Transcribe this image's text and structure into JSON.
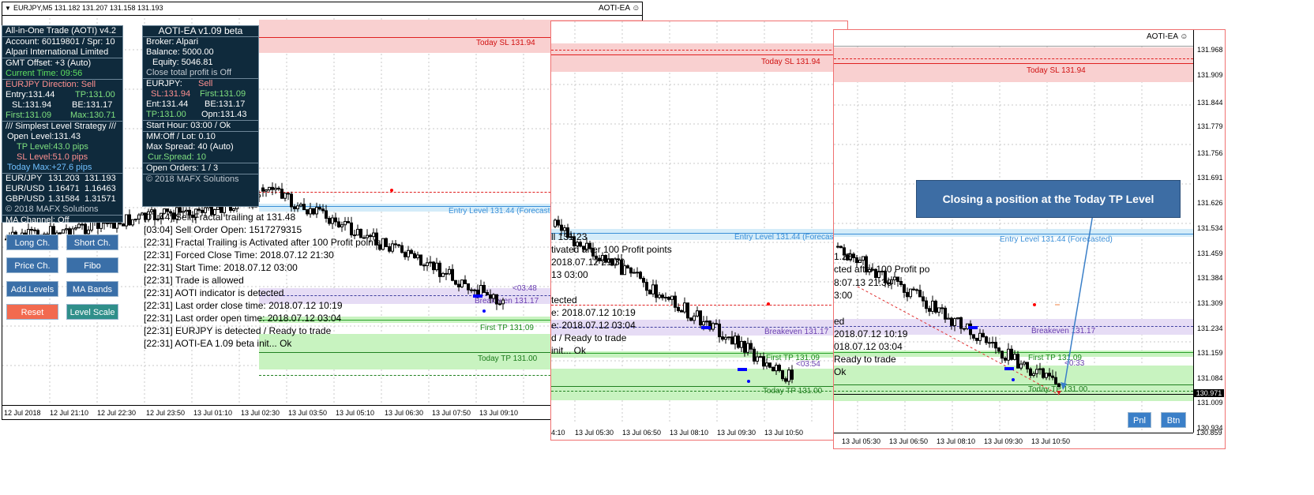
{
  "charts": {
    "c1": {
      "header": "EURJPY,M5  131.182 131.207 131.158 131.193",
      "indicator": "AOTI-EA ☺",
      "sl_label": "Today SL 131.94",
      "entry_label": "Entry Level 131.44 (Forecasted)",
      "be_label": "Breakeven 131.17",
      "first_label": "First TP 131.09",
      "tp_label": "Today TP 131.00",
      "countdown": "<03:48",
      "x_ticks": [
        "12 Jul 2018",
        "12 Jul 21:10",
        "12 Jul 22:30",
        "12 Jul 23:50",
        "13 Jul 01:10",
        "13 Jul 02:30",
        "13 Jul 03:50",
        "13 Jul 05:10",
        "13 Jul 06:30",
        "13 Jul 07:50",
        "13 Jul 09:10"
      ]
    },
    "c2": {
      "sl_label": "Today SL 131.94",
      "entry_label": "Entry Level 131.44 (Forecasted)",
      "be_label": "Breakeven 131.17",
      "first_label": "First TP 131.09",
      "tp_label": "Today TP 131.00",
      "countdown": "<03:54",
      "x_ticks": [
        "4:10",
        "13 Jul 05:30",
        "13 Jul 06:50",
        "13 Jul 08:10",
        "13 Jul 09:30",
        "13 Jul 10:50"
      ],
      "log_lines": [
        "ll 131.23",
        "tivated after 100 Profit points",
        "2018.07.12 21:30",
        "13 03:00",
        "tected",
        "e: 2018.07.12 10:19",
        "e: 2018.07.12 03:04",
        "d / Ready to trade",
        "init... Ok"
      ]
    },
    "c3": {
      "indicator": "AOTI-EA ☺",
      "sl_label": "Today SL 131.94",
      "entry_label": "Entry Level 131.44 (Forecasted)",
      "be_label": "Breakeven 131.17",
      "first_label": "First TP 131.09",
      "tp_label": "Today TP 131.00",
      "countdown": "<0:33",
      "price_ticks": [
        "131.968",
        "131.909",
        "131.844",
        "131.779",
        "131.756",
        "131.691",
        "131.626",
        "131.534",
        "131.459",
        "131.384",
        "131.309",
        "131.234",
        "131.159",
        "131.084",
        "131.009",
        "130.934",
        "130.859"
      ],
      "current_price": "130.971",
      "x_ticks": [
        "13 Jul 05:30",
        "13 Jul 06:50",
        "13 Jul 08:10",
        "13 Jul 09:30",
        "13 Jul 10:50"
      ],
      "log_lines": [
        "1.23",
        "cted after 100 Profit po",
        "8:07.13 21:30",
        "3:00",
        "ed",
        "2018.07.12 10:19",
        "018.07.12 03:04",
        "Ready to trade",
        "Ok"
      ],
      "callout": "Closing a position at the Today TP Level",
      "pnl_button": "Pnl",
      "btn_button": "Btn"
    }
  },
  "aoti_panel": {
    "title": "All-in-One Trade (AOTI) v4.2",
    "account": "Account: 60119801 / Spr: 10",
    "broker": "Alpari International Limited",
    "gmt": "GMT Offset: +3 (Auto)",
    "current_time": "Current Time: 09:56",
    "direction": "EURJPY Direction: Sell",
    "entry": "Entry:131.44",
    "tp": "TP:131.00",
    "sl": "SL:131.94",
    "be": "BE:131.17",
    "first": "First:131.09",
    "max": "Max:130.71",
    "strategy": "/// Simplest Level Strategy ///",
    "open_level": "Open Level:131.43",
    "tp_level": "TP Level:43.0 pips",
    "sl_level": "SL Level:51.0 pips",
    "today_max": "Today Max:+27.6 pips",
    "quotes": [
      {
        "pair": "EUR/JPY",
        "bid": "131.203",
        "ask": "131.193"
      },
      {
        "pair": "EUR/USD",
        "bid": "1.16471",
        "ask": "1.16463"
      },
      {
        "pair": "GBP/USD",
        "bid": "1.31584",
        "ask": "1.31571"
      }
    ],
    "copyright": "© 2018 MAFX Solutions",
    "ma_channel": "MA Channel: Off"
  },
  "buttons": {
    "long_ch": "Long Ch.",
    "short_ch": "Short Ch.",
    "price_ch": "Price Ch.",
    "fibo": "Fibo",
    "add_levels": "Add.Levels",
    "ma_bands": "MA Bands",
    "reset": "Reset",
    "level_scale": "Level Scale"
  },
  "ea_panel": {
    "title": "AOTI-EA v1.09 beta",
    "broker": "Broker: Alpari",
    "balance": "Balance: 5000.00",
    "equity": "Equity: 5046.81",
    "close_profit": "Close total profit is Off",
    "pair": "EURJPY:",
    "side": "Sell",
    "sl": "SL:131.94",
    "first": "First:131.09",
    "ent": "Ent:131.44",
    "be": "BE:131.17",
    "tp": "TP:131.00",
    "opn": "Opn:131.43",
    "start_hour": "Start Hour: 03:00 / Ok",
    "mm": "MM:Off  /  Lot: 0.10",
    "max_spread": "Max Spread: 40 (Auto)",
    "cur_spread": "Cur.Spread: 10",
    "open_orders": "Open Orders: 1 / 3",
    "copyright": "© 2018 MAFX Solutions"
  },
  "log": [
    "[07:44]  Sell Fractal trailing at 131.48",
    "[03:04]  Sell Order Open: 1517279315",
    "[22:31]  Fractal Trailing is Activated after 100 Profit points",
    "[22:31]  Forced Close Time: 2018.07.12 21:30",
    "[22:31]  Start Time: 2018.07.12 03:00",
    "[22:31]  Trade is allowed",
    "[22:31]  AOTI indicator is detected",
    "[22:31]  Last order close time: 2018.07.12 10:19",
    "[22:31]  Last order open time: 2018.07.12 03:04",
    "[22:31]  EURJPY is detected / Ready to trade",
    "[22:31]  AOTI-EA 1.09 beta init... Ok"
  ],
  "colors": {
    "sl_band": "#f9d0d0",
    "tp_band": "#c8f3c0",
    "be_band": "#e6dcf5",
    "entry_band": "#d4ecf9",
    "panel_bg": "#0f2a3c",
    "button_blue": "#3a6fa8",
    "button_green": "#2f8f8a",
    "button_red": "#f26a4f",
    "callout_bg": "#3d6da4"
  }
}
